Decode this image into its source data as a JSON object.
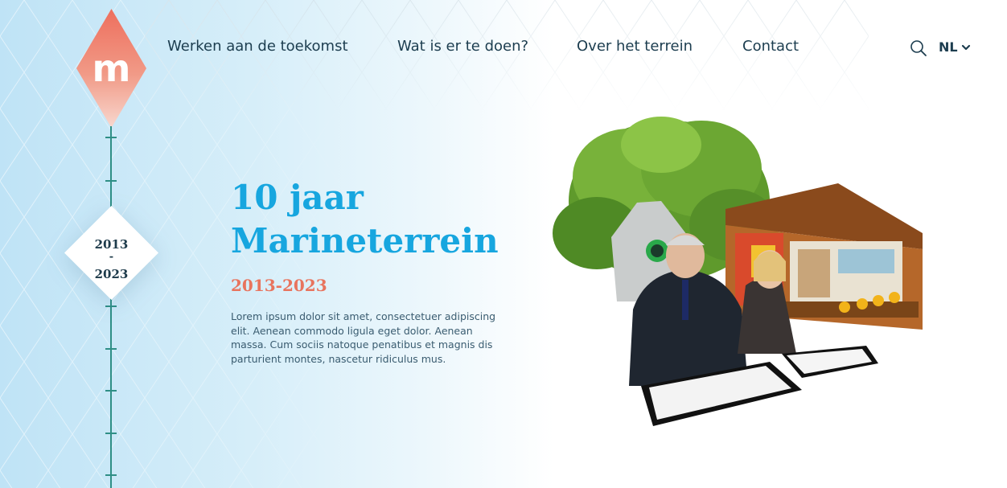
{
  "brand": {
    "logo_letter": "m",
    "logo_color_top": "#ee6f5d",
    "logo_color_bottom": "#f7cfc6"
  },
  "nav": {
    "items": [
      {
        "label": "Werken aan de toekomst"
      },
      {
        "label": "Wat is er te doen?"
      },
      {
        "label": "Over het terrein"
      },
      {
        "label": "Contact"
      }
    ],
    "search_icon": "search-icon",
    "language": {
      "selected": "NL",
      "icon": "chevron-down-icon"
    }
  },
  "timeline": {
    "line_color": "#2f8f86",
    "active": {
      "year_start": "2013",
      "separator": "-",
      "year_end": "2023"
    }
  },
  "hero": {
    "title_line1": "10 jaar",
    "title_line2": "Marineterrein",
    "years": "2013-2023",
    "body": "Lorem ipsum dolor sit amet, consectetuer adipiscing elit. Aenean commodo ligula eget dolor. Aenean massa. Cum sociis natoque penatibus et magnis dis parturient montes, nascetur ridiculus mus."
  },
  "illustration": {
    "description_icon": "collage-image"
  },
  "colors": {
    "accent_blue": "#17a6df",
    "accent_coral": "#e8745e",
    "text_dark": "#1c3d4f"
  }
}
